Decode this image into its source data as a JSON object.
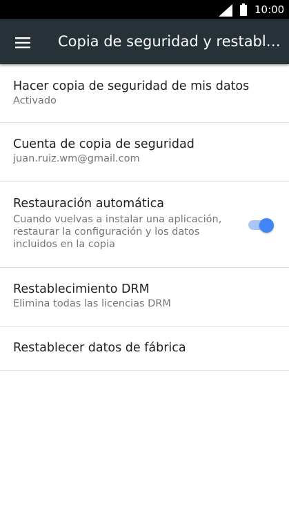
{
  "status_bar": {
    "time": "10:00",
    "icons": [
      "signal-icon",
      "battery-icon"
    ]
  },
  "toolbar": {
    "menu_icon": "hamburger-menu-icon",
    "title": "Copia de seguridad y restable…"
  },
  "items": [
    {
      "primary": "Hacer copia de seguridad de mis datos",
      "secondary": "Activado"
    },
    {
      "primary": "Cuenta de copia de seguridad",
      "secondary": "juan.ruiz.wm@gmail.com"
    },
    {
      "primary": "Restauración automática",
      "secondary": "Cuando vuelvas a instalar una aplicación, restaurar la configuración y los datos incluidos en la copia",
      "toggle_on": true
    },
    {
      "primary": "Restablecimiento DRM",
      "secondary": "Elimina todas las licencias DRM"
    },
    {
      "primary": "Restablecer datos de fábrica"
    }
  ],
  "colors": {
    "toolbar": "#263238",
    "accent": "#4285f4",
    "accent_track": "#a9c6f7"
  }
}
